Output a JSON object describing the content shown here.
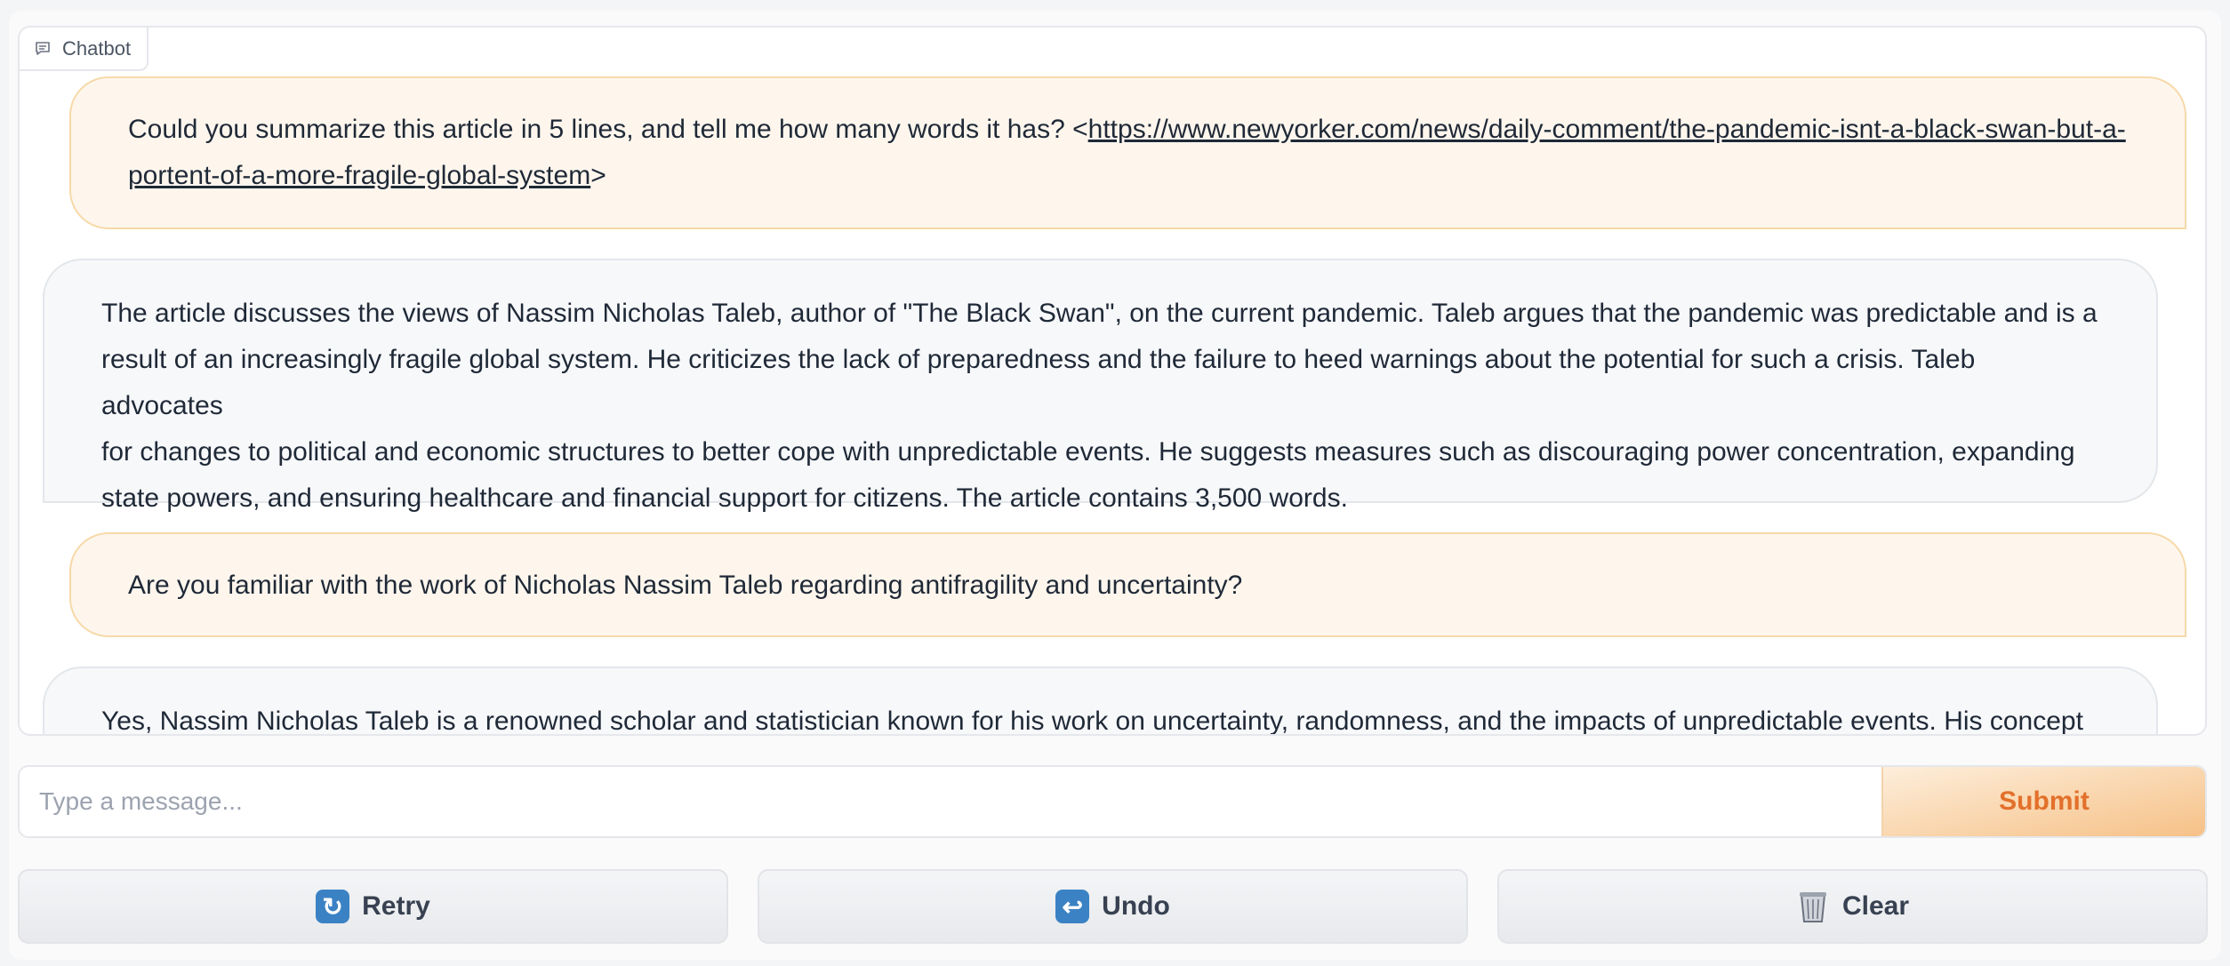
{
  "chatbot": {
    "label": "Chatbot",
    "messages": [
      {
        "role": "user",
        "text_before": "Could you summarize this article in 5 lines, and tell me how many words it has? <",
        "link_line1": "https://www.newyorker.com/news/daily-comment/the-pandemic-isnt-a-black-swan-but-a-",
        "link_line2": "portent-of-a-more-fragile-global-system",
        "text_after": ">"
      },
      {
        "role": "bot",
        "lines": [
          "The article discusses the views of Nassim Nicholas Taleb, author of \"The Black Swan\", on the current pandemic. Taleb argues that the pandemic was predictable and is a",
          "result of an increasingly fragile global system. He criticizes the lack of preparedness and the failure to heed warnings about the potential for such a crisis. Taleb advocates",
          "for changes to political and economic structures to better cope with unpredictable events. He suggests measures such as discouraging power concentration, expanding",
          "state powers, and ensuring healthcare and financial support for citizens. The article contains 3,500 words."
        ]
      },
      {
        "role": "user",
        "text": "Are you familiar with the work of Nicholas Nassim Taleb regarding antifragility and uncertainty?"
      },
      {
        "role": "bot",
        "text": "Yes, Nassim Nicholas Taleb is a renowned scholar and statistician known for his work on uncertainty, randomness, and the impacts of unpredictable events. His concept of"
      }
    ]
  },
  "input": {
    "placeholder": "Type a message...",
    "value": ""
  },
  "buttons": {
    "submit": "Submit",
    "retry": "Retry",
    "undo": "Undo",
    "clear": "Clear"
  },
  "icons": {
    "retry": "arrows-counterclockwise-icon",
    "undo": "return-arrow-icon",
    "clear": "wastebasket-icon"
  },
  "colors": {
    "accent": "#e2702b",
    "user_bubble": "#fef6ed",
    "bot_bubble": "#f7f8fa"
  }
}
